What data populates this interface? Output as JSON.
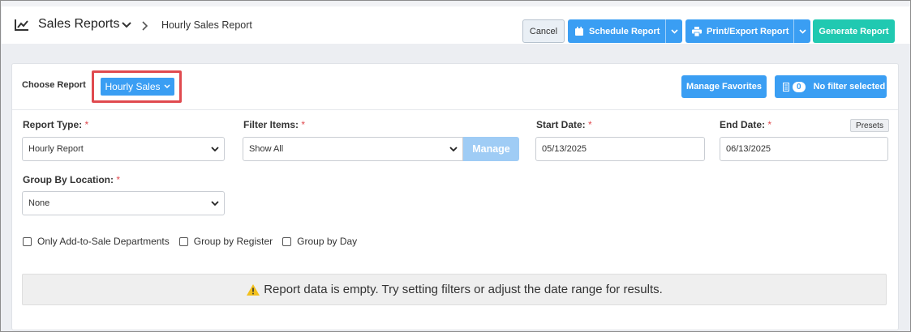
{
  "header": {
    "title": "Sales Reports",
    "breadcrumb": "Hourly Sales Report",
    "cancel_label": "Cancel",
    "schedule_label": "Schedule Report",
    "print_label": "Print/Export Report",
    "generate_label": "Generate Report",
    "icons": [
      "chart-line-icon",
      "chevron-down-icon",
      "chevron-right-icon",
      "calendar-icon",
      "printer-icon"
    ]
  },
  "report_bar": {
    "choose_label": "Choose Report",
    "selected_report": "Hourly Sales",
    "manage_favorites_label": "Manage Favorites",
    "filter_count": "0",
    "no_filter_label": "No filter selected"
  },
  "form": {
    "report_type": {
      "label": "Report Type:",
      "required_mark": "*",
      "value": "Hourly Report"
    },
    "filter_items": {
      "label": "Filter Items:",
      "required_mark": "*",
      "value": "Show All",
      "manage_label": "Manage"
    },
    "start_date": {
      "label": "Start Date:",
      "required_mark": "*",
      "value": "05/13/2025"
    },
    "end_date": {
      "label": "End Date:",
      "required_mark": "*",
      "value": "06/13/2025",
      "presets_label": "Presets"
    },
    "group_by_location": {
      "label": "Group By Location:",
      "required_mark": "*",
      "value": "None"
    },
    "checkboxes": [
      {
        "label": "Only Add-to-Sale Departments",
        "checked": false
      },
      {
        "label": "Group by Register",
        "checked": false
      },
      {
        "label": "Group by Day",
        "checked": false
      }
    ]
  },
  "alert": {
    "icon": "warning-icon",
    "message": "Report data is empty. Try setting filters or adjust the date range for results."
  },
  "colors": {
    "primary": "#3a9ef3",
    "accent_teal": "#20c9b1",
    "highlight_red": "#e04a4f",
    "warning": "#f2c01c"
  }
}
